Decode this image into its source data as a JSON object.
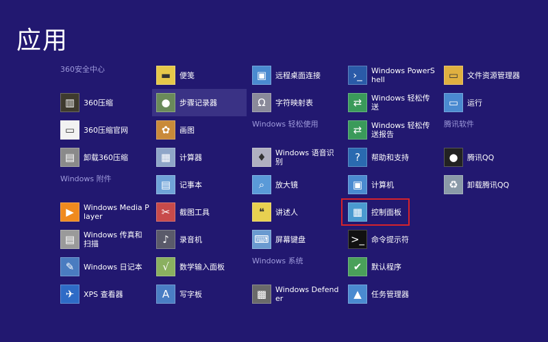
{
  "page_title": "应用",
  "columns": [
    [
      {
        "kind": "header",
        "label": "360安全中心"
      },
      {
        "kind": "app",
        "label": "360压缩",
        "icon": "books-icon",
        "color": "#3e3a2e",
        "glyph": "▥"
      },
      {
        "kind": "app",
        "label": "360压缩官网",
        "icon": "document-icon",
        "color": "#f2f2f2",
        "glyph": "▭"
      },
      {
        "kind": "app",
        "label": "卸载360压缩",
        "icon": "trash-icon",
        "color": "#8a8a8a",
        "glyph": "▤"
      },
      {
        "kind": "header",
        "label": "Windows 附件"
      },
      {
        "kind": "app",
        "label": "Windows Media Player",
        "icon": "media-player-icon",
        "color": "#f08a1e",
        "glyph": "▶"
      },
      {
        "kind": "app",
        "label": "Windows 传真和扫描",
        "icon": "fax-icon",
        "color": "#9a9a9a",
        "glyph": "▤"
      },
      {
        "kind": "app",
        "label": "Windows 日记本",
        "icon": "journal-icon",
        "color": "#4a7cc0",
        "glyph": "✎"
      },
      {
        "kind": "app",
        "label": "XPS 查看器",
        "icon": "xps-viewer-icon",
        "color": "#2e6bc6",
        "glyph": "✈"
      }
    ],
    [
      {
        "kind": "app",
        "label": "便笺",
        "icon": "sticky-notes-icon",
        "color": "#e6c84a",
        "glyph": "▬"
      },
      {
        "kind": "app",
        "label": "步骤记录器",
        "icon": "steps-recorder-icon",
        "color": "#6a8a5a",
        "glyph": "●",
        "hover": true
      },
      {
        "kind": "app",
        "label": "画图",
        "icon": "paint-icon",
        "color": "#c98a3a",
        "glyph": "✿"
      },
      {
        "kind": "app",
        "label": "计算器",
        "icon": "calculator-icon",
        "color": "#8fa6c8",
        "glyph": "▦"
      },
      {
        "kind": "app",
        "label": "记事本",
        "icon": "notepad-icon",
        "color": "#6fa3d8",
        "glyph": "▤"
      },
      {
        "kind": "app",
        "label": "截图工具",
        "icon": "snipping-tool-icon",
        "color": "#c84a4a",
        "glyph": "✂"
      },
      {
        "kind": "app",
        "label": "录音机",
        "icon": "sound-recorder-icon",
        "color": "#5a5a6a",
        "glyph": "♪"
      },
      {
        "kind": "app",
        "label": "数学输入面板",
        "icon": "math-input-icon",
        "color": "#8ab060",
        "glyph": "√"
      },
      {
        "kind": "app",
        "label": "写字板",
        "icon": "wordpad-icon",
        "color": "#4a7ec4",
        "glyph": "A"
      }
    ],
    [
      {
        "kind": "app",
        "label": "远程桌面连接",
        "icon": "remote-desktop-icon",
        "color": "#4a8ad0",
        "glyph": "▣"
      },
      {
        "kind": "app",
        "label": "字符映射表",
        "icon": "character-map-icon",
        "color": "#8a8a9a",
        "glyph": "Ω"
      },
      {
        "kind": "header",
        "label": "Windows 轻松使用"
      },
      {
        "kind": "app",
        "label": "Windows 语音识别",
        "icon": "microphone-icon",
        "color": "#b0b0c0",
        "glyph": "♦"
      },
      {
        "kind": "app",
        "label": "放大镜",
        "icon": "magnifier-icon",
        "color": "#5a9ad8",
        "glyph": "⌕"
      },
      {
        "kind": "app",
        "label": "讲述人",
        "icon": "narrator-icon",
        "color": "#e8d050",
        "glyph": "❝"
      },
      {
        "kind": "app",
        "label": "屏幕键盘",
        "icon": "keyboard-icon",
        "color": "#6a9ad0",
        "glyph": "⌨"
      },
      {
        "kind": "header",
        "label": "Windows 系统"
      },
      {
        "kind": "app",
        "label": "Windows Defender",
        "icon": "defender-icon",
        "color": "#6a6a6a",
        "glyph": "▩"
      }
    ],
    [
      {
        "kind": "app",
        "label": "Windows PowerShell",
        "icon": "powershell-icon",
        "color": "#2a5aa8",
        "glyph": "›_"
      },
      {
        "kind": "app",
        "label": "Windows 轻松传送",
        "icon": "easy-transfer-icon",
        "color": "#3a9a5a",
        "glyph": "⇄"
      },
      {
        "kind": "app",
        "label": "Windows 轻松传送报告",
        "icon": "easy-transfer-report-icon",
        "color": "#3a9a5a",
        "glyph": "⇄"
      },
      {
        "kind": "app",
        "label": "帮助和支持",
        "icon": "help-icon",
        "color": "#2a6ab0",
        "glyph": "?"
      },
      {
        "kind": "app",
        "label": "计算机",
        "icon": "computer-icon",
        "color": "#4a8ad0",
        "glyph": "▣"
      },
      {
        "kind": "app",
        "label": "控制面板",
        "icon": "control-panel-icon",
        "color": "#4a9ad0",
        "glyph": "▦",
        "selected": true
      },
      {
        "kind": "app",
        "label": "命令提示符",
        "icon": "command-prompt-icon",
        "color": "#111111",
        "glyph": ">_"
      },
      {
        "kind": "app",
        "label": "默认程序",
        "icon": "default-programs-icon",
        "color": "#4aa05a",
        "glyph": "✔"
      },
      {
        "kind": "app",
        "label": "任务管理器",
        "icon": "task-manager-icon",
        "color": "#4a8ad0",
        "glyph": "▲"
      }
    ],
    [
      {
        "kind": "app",
        "label": "文件资源管理器",
        "icon": "file-explorer-icon",
        "color": "#e0b040",
        "glyph": "▭"
      },
      {
        "kind": "app",
        "label": "运行",
        "icon": "run-icon",
        "color": "#4a8ad0",
        "glyph": "▭"
      },
      {
        "kind": "header",
        "label": "腾讯软件"
      },
      {
        "kind": "app",
        "label": "腾讯QQ",
        "icon": "qq-penguin-icon",
        "color": "#222222",
        "glyph": "●"
      },
      {
        "kind": "app",
        "label": "卸载腾讯QQ",
        "icon": "recycle-bin-icon",
        "color": "#8a9aa8",
        "glyph": "♻"
      }
    ]
  ]
}
